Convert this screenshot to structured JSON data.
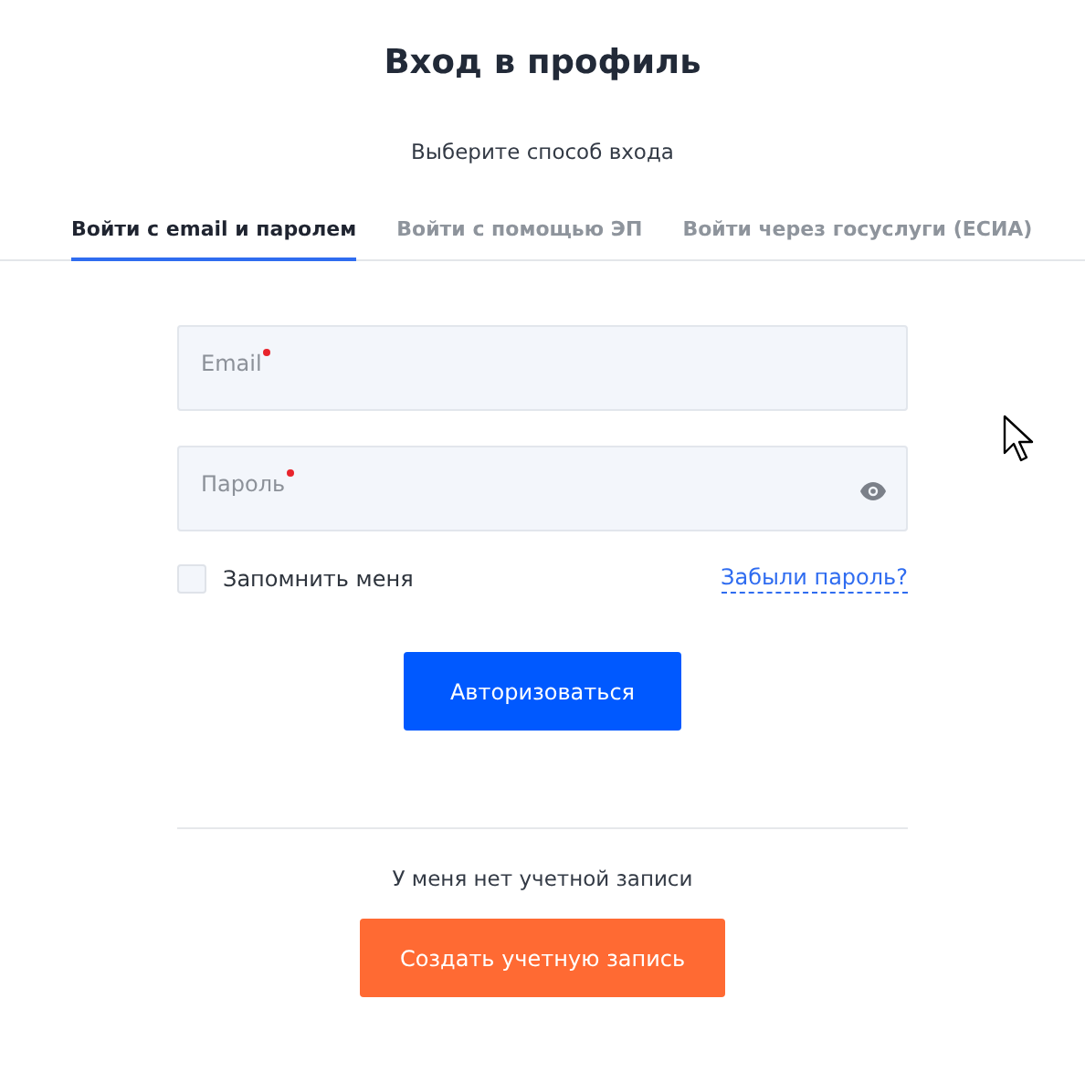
{
  "title": "Вход в профиль",
  "subtitle": "Выберите способ входа",
  "tabs": [
    {
      "label": "Войти с email и паролем",
      "selected": true
    },
    {
      "label": "Войти с помощью ЭП",
      "selected": false
    },
    {
      "label": "Войти через госуслуги (ЕСИА)",
      "selected": false
    }
  ],
  "fields": [
    {
      "label": "Email",
      "required": true,
      "kind": "text"
    },
    {
      "label": "Пароль",
      "required": true,
      "kind": "password"
    }
  ],
  "remember": {
    "label": "Запомнить меня",
    "checked": false
  },
  "forgot_link": "Забыли пароль?",
  "submit_button": "Авторизоваться",
  "no_account_text": "У меня нет учетной записи",
  "register_button": "Создать учетную запись"
}
